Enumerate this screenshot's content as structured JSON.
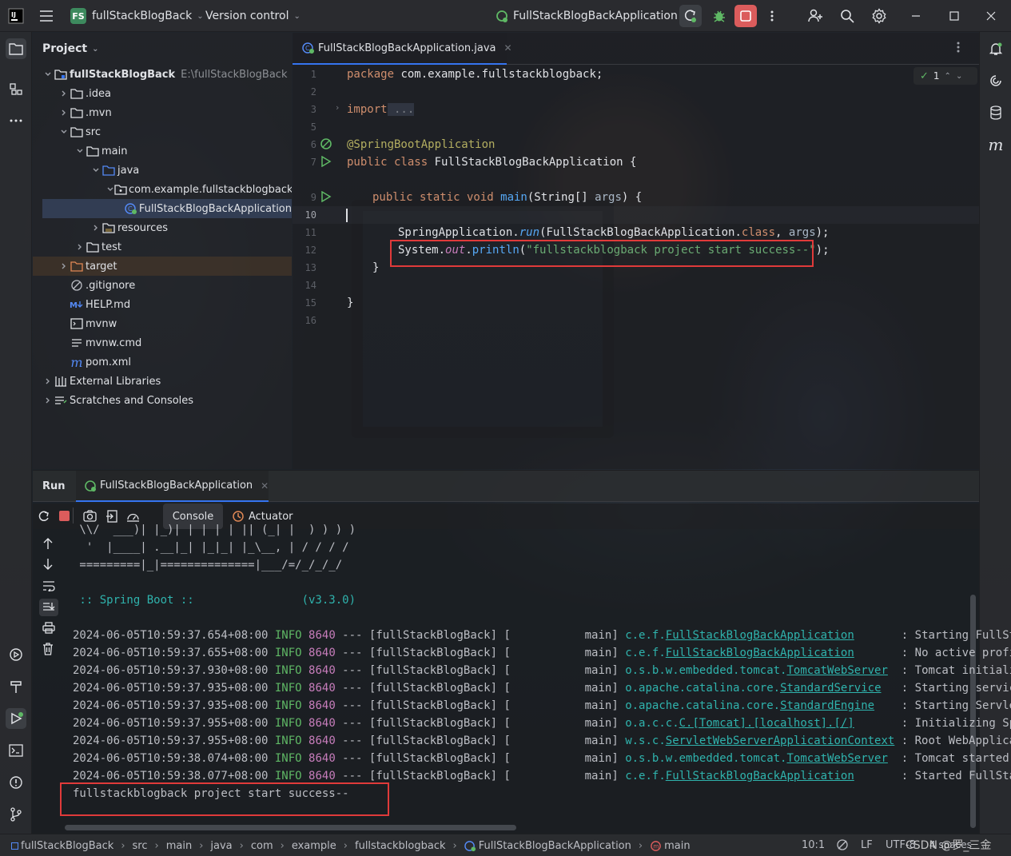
{
  "titlebar": {
    "project_badge": "FS",
    "project_name": "fullStackBlogBack",
    "vcs": "Version control",
    "run_config": "FullStackBlogBackApplication"
  },
  "project_panel": {
    "title": "Project",
    "tree": [
      {
        "label": "fullStackBlogBack",
        "suffix": "E:\\fullStackBlogBack",
        "icon": "folder-module-icon",
        "arrow": "down"
      },
      {
        "label": ".idea",
        "icon": "folder-icon",
        "arrow": "right"
      },
      {
        "label": ".mvn",
        "icon": "folder-icon",
        "arrow": "right"
      },
      {
        "label": "src",
        "icon": "folder-icon",
        "arrow": "down"
      },
      {
        "label": "main",
        "icon": "folder-icon",
        "arrow": "down"
      },
      {
        "label": "java",
        "icon": "source-folder-icon",
        "arrow": "down"
      },
      {
        "label": "com.example.fullstackblogback",
        "icon": "package-icon",
        "arrow": "down"
      },
      {
        "label": "FullStackBlogBackApplication",
        "icon": "spring-class-icon",
        "arrow": ""
      },
      {
        "label": "resources",
        "icon": "resources-folder-icon",
        "arrow": "right"
      },
      {
        "label": "test",
        "icon": "folder-icon",
        "arrow": "right"
      },
      {
        "label": "target",
        "icon": "excluded-folder-icon",
        "arrow": "right"
      },
      {
        "label": ".gitignore",
        "icon": "ignore-file-icon",
        "arrow": ""
      },
      {
        "label": "HELP.md",
        "icon": "markdown-icon",
        "arrow": ""
      },
      {
        "label": "mvnw",
        "icon": "terminal-file-icon",
        "arrow": ""
      },
      {
        "label": "mvnw.cmd",
        "icon": "text-file-icon",
        "arrow": ""
      },
      {
        "label": "pom.xml",
        "icon": "maven-icon",
        "arrow": ""
      },
      {
        "label": "External Libraries",
        "icon": "library-icon",
        "arrow": "right"
      },
      {
        "label": "Scratches and Consoles",
        "icon": "scratches-icon",
        "arrow": "right"
      }
    ]
  },
  "editor": {
    "tab": "FullStackBlogBackApplication.java",
    "inspection_count": "1",
    "line_numbers": [
      "1",
      "2",
      "3",
      "5",
      "6",
      "7",
      "9",
      "10",
      "11",
      "12",
      "13",
      "14",
      "15",
      "16"
    ],
    "code": {
      "l1_kw": "package",
      "l1_rest": " com.example.fullstackblogback;",
      "l3_kw": "import",
      "l3_fold": " ...",
      "l6": "@SpringBootApplication",
      "l7_kw": "public class",
      "l7_rest": " FullStackBlogBackApplication {",
      "l9_kw1": "public static void",
      "l9_fn": " main",
      "l9_rest1": "(String[] ",
      "l9_par": "args",
      "l9_rest2": ") {",
      "l11_a": "SpringApplication.",
      "l11_fn": "run",
      "l11_b": "(FullStackBlogBackApplication.",
      "l11_kw": "class",
      "l11_c": ", ",
      "l11_par": "args",
      "l11_d": ");",
      "l12_a": "System.",
      "l12_fld": "out",
      "l12_b": ".",
      "l12_fn": "println",
      "l12_c": "(",
      "l12_str": "\"fullstackblogback project start success--\"",
      "l12_d": ");",
      "l13": "}",
      "l15": "}"
    }
  },
  "run": {
    "label": "Run",
    "tab": "FullStackBlogBackApplication",
    "console_tab": "Console",
    "actuator_tab": "Actuator",
    "banner": [
      " \\\\/  ___)| |_)| | | | | || (_| |  ) ) ) )",
      "  '  |____| .__|_| |_|_| |_\\__, | / / / /",
      " =========|_|==============|___/=/_/_/_/"
    ],
    "spring_boot": " :: Spring Boot ::                (v3.3.0)",
    "log": [
      {
        "ts": "2024-06-05T10:59:37.654+08:00",
        "lvl": "INFO",
        "pid": "8640",
        "sep": " --- [fullStackBlogBack] [           main] ",
        "logger_pre": "c.e.f.",
        "logger": "FullStackBlogBackApplication",
        "msg": "       : Starting FullSta"
      },
      {
        "ts": "2024-06-05T10:59:37.655+08:00",
        "lvl": "INFO",
        "pid": "8640",
        "sep": " --- [fullStackBlogBack] [           main] ",
        "logger_pre": "c.e.f.",
        "logger": "FullStackBlogBackApplication",
        "msg": "       : No active profil"
      },
      {
        "ts": "2024-06-05T10:59:37.930+08:00",
        "lvl": "INFO",
        "pid": "8640",
        "sep": " --- [fullStackBlogBack] [           main] ",
        "logger_pre": "o.s.b.w.embedded.tomcat.",
        "logger": "TomcatWebServer",
        "msg": "  : Tomcat initializ"
      },
      {
        "ts": "2024-06-05T10:59:37.935+08:00",
        "lvl": "INFO",
        "pid": "8640",
        "sep": " --- [fullStackBlogBack] [           main] ",
        "logger_pre": "o.apache.catalina.core.",
        "logger": "StandardService",
        "msg": "   : Starting service"
      },
      {
        "ts": "2024-06-05T10:59:37.935+08:00",
        "lvl": "INFO",
        "pid": "8640",
        "sep": " --- [fullStackBlogBack] [           main] ",
        "logger_pre": "o.apache.catalina.core.",
        "logger": "StandardEngine",
        "msg": "    : Starting Servlet"
      },
      {
        "ts": "2024-06-05T10:59:37.955+08:00",
        "lvl": "INFO",
        "pid": "8640",
        "sep": " --- [fullStackBlogBack] [           main] ",
        "logger_pre": "o.a.c.c.",
        "logger": "C.[Tomcat].[localhost].[/]",
        "msg": "       : Initializing Spr"
      },
      {
        "ts": "2024-06-05T10:59:37.955+08:00",
        "lvl": "INFO",
        "pid": "8640",
        "sep": " --- [fullStackBlogBack] [           main] ",
        "logger_pre": "w.s.c.",
        "logger": "ServletWebServerApplicationContext",
        "msg": " : Root WebApplicat"
      },
      {
        "ts": "2024-06-05T10:59:38.074+08:00",
        "lvl": "INFO",
        "pid": "8640",
        "sep": " --- [fullStackBlogBack] [           main] ",
        "logger_pre": "o.s.b.w.embedded.tomcat.",
        "logger": "TomcatWebServer",
        "msg": "  : Tomcat started o"
      },
      {
        "ts": "2024-06-05T10:59:38.077+08:00",
        "lvl": "INFO",
        "pid": "8640",
        "sep": " --- [fullStackBlogBack] [           main] ",
        "logger_pre": "c.e.f.",
        "logger": "FullStackBlogBackApplication",
        "msg": "       : Started FullStac"
      }
    ],
    "output": "fullstackblogback project start success--"
  },
  "statusbar": {
    "crumbs": [
      "fullStackBlogBack",
      "src",
      "main",
      "java",
      "com",
      "example",
      "fullstackblogback",
      "FullStackBlogBackApplication",
      "main"
    ],
    "position": "10:1",
    "line_sep": "LF",
    "encoding": "UTF-8",
    "indent": "4 spaces",
    "watermark": "CSDN @罗_三金"
  },
  "colors": {
    "accent": "#3574f0",
    "highlight_box": "#e03a3a",
    "stop": "#db5c5c"
  }
}
